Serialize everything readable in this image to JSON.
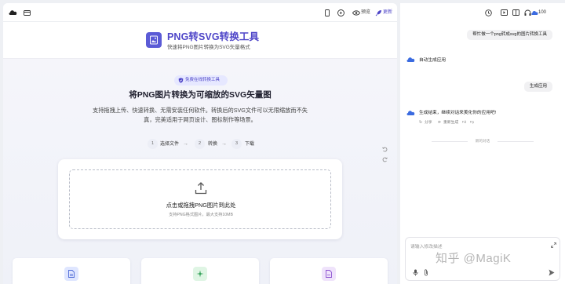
{
  "toolbar": {
    "logo_icon": "cloud-logo-icon",
    "preview_label": "预览",
    "publish_label": "更新"
  },
  "app": {
    "title": "PNG转SVG转换工具",
    "subtitle": "快速将PNG图片转换为SVG矢量格式"
  },
  "hero": {
    "badge": "免费在线转换工具",
    "title": "将PNG图片转换为可缩放的SVG矢量图",
    "description": "支持拖拽上传、快速转换、无需安装任何软件。转换后的SVG文件可以无限缩放而不失真，完美适用于网页设计、图标制作等场景。"
  },
  "steps": [
    {
      "num": "1",
      "label": "选择文件"
    },
    {
      "num": "2",
      "label": "转换"
    },
    {
      "num": "3",
      "label": "下载"
    }
  ],
  "upload": {
    "title": "点击或拖拽PNG图片到此处",
    "hint": "支持PNG格式图片，最大支持10MB"
  },
  "chat": {
    "credits": "100",
    "messages": [
      {
        "role": "user",
        "text": "帮忙做一个png转成svg的图片转换工具"
      },
      {
        "role": "bot",
        "text": "自动生成应用"
      },
      {
        "role": "user",
        "text": "生成应用"
      },
      {
        "role": "bot",
        "text": "生成结束，继续对话来美化你的应用吧!"
      }
    ],
    "actions": {
      "share": "分享",
      "regenerate": "重新生成"
    },
    "divider": "新的对话",
    "input_placeholder": "请输入修改描述",
    "watermark": "知乎 @MagiK"
  },
  "colors": {
    "accent": "#4f46c8",
    "badge_bg": "#e6e8ff",
    "feature_1": "#dfe6ff",
    "feature_2": "#dff5e4",
    "feature_3": "#efe3fb"
  }
}
